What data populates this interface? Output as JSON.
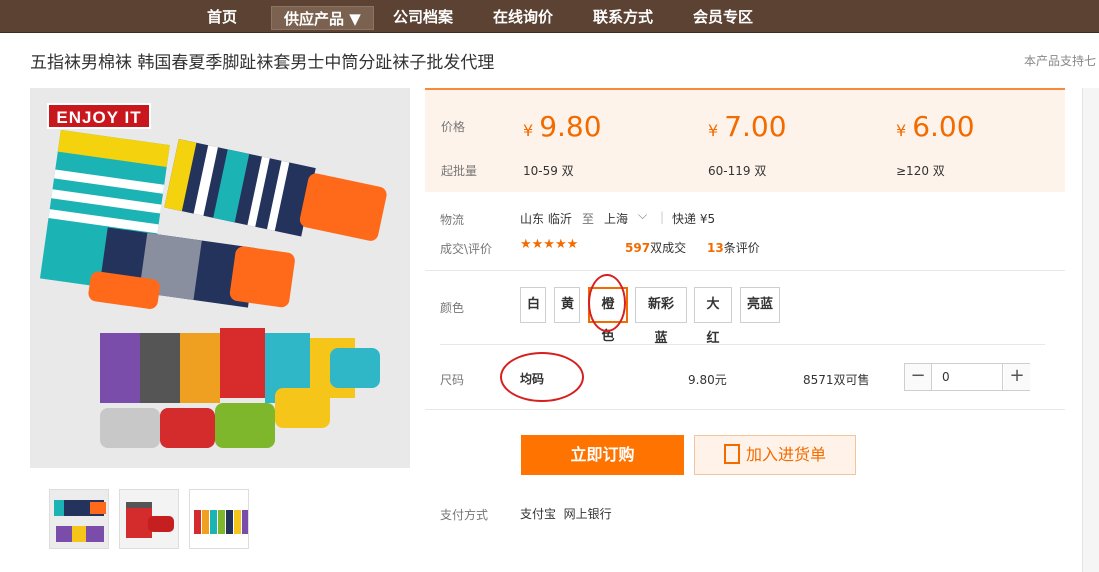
{
  "nav": {
    "items": [
      "首页",
      "供应产品 ▼",
      "公司档案",
      "在线询价",
      "联系方式",
      "会员专区"
    ],
    "active_index": 1
  },
  "product": {
    "title": "五指袜男棉袜 韩国春夏季脚趾袜套男士中筒分趾袜子批发代理",
    "support_note": "本产品支持七",
    "image_badge": "ENJOY IT"
  },
  "price_table": {
    "price_label": "价格",
    "qty_label": "起批量",
    "currency": "¥",
    "tiers": [
      {
        "price": "9.80",
        "qty": "10-59 双"
      },
      {
        "price": "7.00",
        "qty": "60-119 双"
      },
      {
        "price": "6.00",
        "qty": "≥120 双"
      }
    ]
  },
  "logistics": {
    "label": "物流",
    "from": "山东 临沂",
    "to_word": "至",
    "to": "上海",
    "shipping": "快递 ¥5"
  },
  "reviews": {
    "label": "成交\\评价",
    "stars": "★★★★★",
    "sold_count": "597",
    "sold_suffix": "双成交",
    "review_count": "13",
    "review_suffix": "条评价"
  },
  "colors": {
    "label": "颜色",
    "options": [
      "白",
      "黄",
      "橙色",
      "新彩蓝",
      "大红",
      "亮蓝"
    ],
    "selected": "橙色"
  },
  "size": {
    "label": "尺码",
    "value": "均码",
    "price": "9.80元",
    "stock": "8571双可售",
    "quantity": "0",
    "minus": "−",
    "plus": "+"
  },
  "actions": {
    "order": "立即订购",
    "add_cart": "加入进货单"
  },
  "payment": {
    "label": "支付方式",
    "methods": "支付宝  网上银行"
  },
  "colors_theme": {
    "nav_bg": "#5b4233",
    "accent": "#f26b00",
    "price_bg": "#fef3ea",
    "highlight_ring": "#d62020"
  }
}
